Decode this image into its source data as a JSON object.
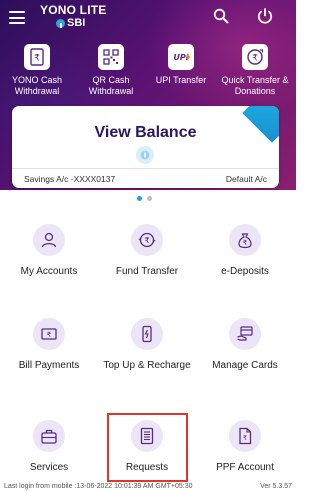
{
  "app": {
    "logo_line1": "YONO LITE",
    "logo_line2": "SBI"
  },
  "quick_actions": [
    {
      "label": "YONO Cash Withdrawal",
      "icon": "rupee-document-icon"
    },
    {
      "label": "QR Cash Withdrawal",
      "icon": "qr-code-icon"
    },
    {
      "label": "UPI Transfer",
      "icon": "upi-icon"
    },
    {
      "label": "Quick Transfer & Donations",
      "icon": "rupee-transfer-icon"
    }
  ],
  "balance_card": {
    "title": "View Balance",
    "account": "Savings A/c -XXXX0137",
    "default_label": "Default A/c"
  },
  "carousel": {
    "pages": 2,
    "active": 0
  },
  "services": [
    {
      "label": "My Accounts",
      "icon": "user-account-icon"
    },
    {
      "label": "Fund Transfer",
      "icon": "fund-transfer-icon"
    },
    {
      "label": "e-Deposits",
      "icon": "money-bag-icon"
    },
    {
      "label": "Bill Payments",
      "icon": "bill-payment-icon"
    },
    {
      "label": "Top Up & Recharge",
      "icon": "mobile-recharge-icon"
    },
    {
      "label": "Manage Cards",
      "icon": "card-in-hand-icon"
    },
    {
      "label": "Services",
      "icon": "briefcase-icon"
    },
    {
      "label": "Requests",
      "icon": "document-list-icon"
    },
    {
      "label": "PPF Account",
      "icon": "ppf-document-icon"
    }
  ],
  "footer": {
    "last_login": "Last login from mobile :13-06-2022 10:01:39 AM GMT+05:30",
    "version": "Ver 5.3.57"
  },
  "colors": {
    "header_gradient_start": "#2b0f5c",
    "header_gradient_end": "#8a1f6e",
    "accent_blue": "#2a9ee0",
    "icon_bg": "#ece5f7",
    "icon_stroke": "#5a2a82",
    "highlight_red": "#e0352b"
  }
}
